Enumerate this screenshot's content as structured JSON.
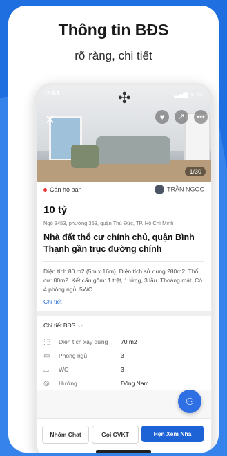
{
  "promo": {
    "headline": "Thông tin BĐS",
    "subline": "rõ ràng, chi tiết"
  },
  "phone": {
    "time": "9:41",
    "status_icons": "▂▄▆ ᯤ ▭",
    "photo_counter": "1/30",
    "category": "Căn hộ bán",
    "owner": "TRẦN NGỌC",
    "price": "10 tỷ",
    "address": "Ngõ 3453, phường 353, quận Thủ Đức, TP. Hồ Chí Minh",
    "title": "Nhà đất thổ cư chính chủ, quận Bình Thạnh gần trục đường chính",
    "description": "Diện tích 80 m2 (5m x 16m). Diện tích sử dụng 280m2. Thổ cư: 80m2. Kết cấu gồm: 1 trệt, 1 lửng, 3 lầu. Thoáng mát. Có 4 phòng ngủ, 5WC....",
    "more_link": "Chi tiết",
    "details_header": "Chi tiết BĐS",
    "details": [
      {
        "icon": "area-icon",
        "label": "Diện tích xây dựng",
        "value": "70 m2"
      },
      {
        "icon": "bed-icon",
        "label": "Phòng ngủ",
        "value": "3"
      },
      {
        "icon": "bath-icon",
        "label": "WC",
        "value": "3"
      },
      {
        "icon": "compass-icon",
        "label": "Hướng",
        "value": "Đông Nam"
      }
    ],
    "buttons": {
      "chat": "Nhóm Chat",
      "call": "Gọi CVKT",
      "book": "Hẹn Xem Nhà"
    }
  },
  "colors": {
    "brand": "#1e63d6",
    "background": "#1f6fe0"
  }
}
